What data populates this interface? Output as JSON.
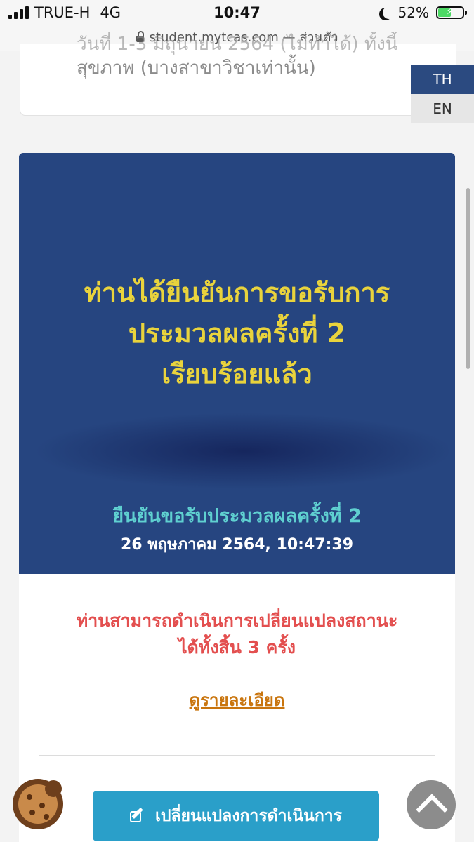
{
  "status_bar": {
    "carrier": "TRUE-H",
    "network": "4G",
    "time": "10:47",
    "battery": "52%",
    "battery_level": 0.52,
    "url": "student.mytcas.com — ส่วนตัว"
  },
  "top_card": {
    "line1": "วันที่ 1-3 มิถุนายน 2564 (ไม่ทำได้) ทั้งนี้",
    "line2": "สุขภาพ (บางสาขาวิชาเท่านั้น)"
  },
  "language": {
    "th": "TH",
    "en": "EN",
    "active": "TH"
  },
  "result": {
    "title_lines": [
      "ท่านได้ยืนยันการขอรับการ",
      "ประมวลผลครั้งที่ 2",
      "เรียบร้อยแล้ว"
    ],
    "confirm_label": "ยืนยันขอรับประมวลผลครั้งที่ 2",
    "confirm_datetime": "26 พฤษภาคม 2564, 10:47:39"
  },
  "info": {
    "remaining_lines": [
      "ท่านสามารถดำเนินการเปลี่ยนแปลงสถานะ",
      "ได้ทั้งสิ้น 3 ครั้ง"
    ],
    "detail_link": "ดูรายละเอียด",
    "change_button": "เปลี่ยนแปลงการดำเนินการ"
  },
  "icons": {
    "cookie": "cookie-icon",
    "scroll_top": "chevron-up-icon",
    "edit": "edit-icon"
  },
  "colors": {
    "card_blue": "#264580",
    "title_yellow": "#e9d33c",
    "confirm_teal": "#5fd0d0",
    "warning_red": "#e34f4f",
    "link_orange": "#c9750e",
    "button_blue": "#2a9fc9"
  }
}
